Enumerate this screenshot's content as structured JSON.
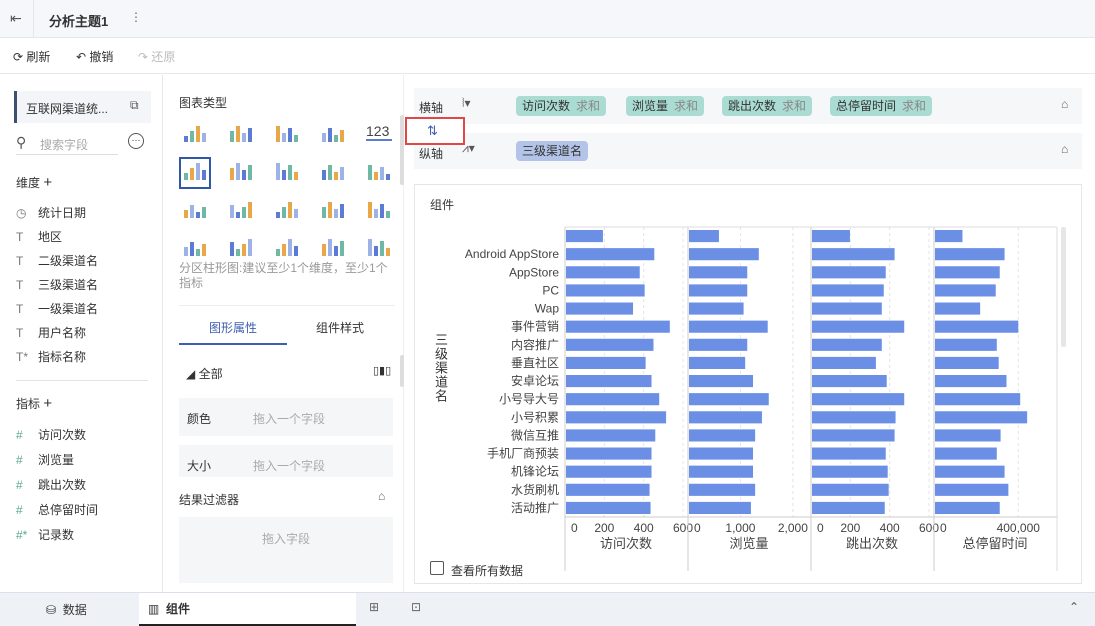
{
  "topbar": {
    "title": "分析主题1",
    "more": "⋮"
  },
  "toolbar": {
    "refresh": "刷新",
    "undo": "撤销",
    "redo": "还原"
  },
  "left": {
    "dataset": "互联网渠道统...",
    "search_placeholder": "搜索字段",
    "dimensions_label": "维度",
    "dimensions": [
      {
        "icon": "clock",
        "label": "统计日期"
      },
      {
        "icon": "T",
        "label": "地区"
      },
      {
        "icon": "T",
        "label": "二级渠道名"
      },
      {
        "icon": "T",
        "label": "三级渠道名"
      },
      {
        "icon": "T",
        "label": "一级渠道名"
      },
      {
        "icon": "T",
        "label": "用户名称"
      },
      {
        "icon": "T*",
        "label": "指标名称"
      }
    ],
    "measures_label": "指标",
    "measures": [
      {
        "icon": "#",
        "label": "访问次数"
      },
      {
        "icon": "#",
        "label": "浏览量"
      },
      {
        "icon": "#",
        "label": "跳出次数"
      },
      {
        "icon": "#",
        "label": "总停留时间"
      },
      {
        "icon": "#*",
        "label": "记录数"
      }
    ]
  },
  "mid": {
    "chart_type_label": "图表类型",
    "hint": "分区柱形图:建议至少1个维度，至少1个指标",
    "tabs": [
      "图形属性",
      "组件样式"
    ],
    "all_label": "全部",
    "color_label": "颜色",
    "color_placeholder": "拖入一个字段",
    "size_label": "大小",
    "size_placeholder": "拖入一个字段",
    "filter_label": "结果过滤器",
    "filter_placeholder": "拖入字段"
  },
  "axes": {
    "x_label": "横轴",
    "y_label": "纵轴",
    "x_pills": [
      {
        "name": "访问次数",
        "agg": "求和"
      },
      {
        "name": "浏览量",
        "agg": "求和"
      },
      {
        "name": "跳出次数",
        "agg": "求和"
      },
      {
        "name": "总停留时间",
        "agg": "求和"
      }
    ],
    "y_pills": [
      {
        "name": "三级渠道名"
      }
    ]
  },
  "component": {
    "title": "组件",
    "show_all": "查看所有数据"
  },
  "bottom": {
    "tabs": [
      "数据",
      "组件"
    ]
  },
  "colors": {
    "bar": "#6c8fe6",
    "accent": "#3d5fb0",
    "pill_x": "#aadcd3",
    "pill_y": "#b3c4e8",
    "highlight": "#e04848"
  },
  "chart_data": {
    "type": "bar",
    "orientation": "horizontal",
    "ylabel": "三级渠道名",
    "categories": [
      "",
      "Android AppStore",
      "AppStore",
      "PC",
      "Wap",
      "事件营销",
      "内容推广",
      "垂直社区",
      "安卓论坛",
      "小号导大号",
      "小号积累",
      "微信互推",
      "手机厂商预装",
      "机锋论坛",
      "水货刷机",
      "活动推广"
    ],
    "panels": [
      {
        "name": "访问次数",
        "ticks": [
          "0",
          "200",
          "400",
          "600"
        ],
        "tick_values": [
          0,
          200,
          400,
          600
        ],
        "xlim": [
          0,
          600
        ],
        "values": [
          193,
          454,
          380,
          405,
          346,
          533,
          450,
          410,
          440,
          479,
          514,
          459,
          440,
          440,
          430,
          435
        ]
      },
      {
        "name": "浏览量",
        "ticks": [
          "0",
          "1,000",
          "2,000"
        ],
        "tick_values": [
          0,
          1000,
          2000
        ],
        "xlim": [
          0,
          2250
        ],
        "values": [
          590,
          1350,
          1130,
          1130,
          1060,
          1520,
          1130,
          1090,
          1240,
          1540,
          1410,
          1280,
          1240,
          1240,
          1280,
          1200
        ]
      },
      {
        "name": "跳出次数",
        "ticks": [
          "0",
          "200",
          "400",
          "600"
        ],
        "tick_values": [
          0,
          200,
          400,
          600
        ],
        "xlim": [
          0,
          600
        ],
        "values": [
          198,
          425,
          380,
          370,
          360,
          474,
          360,
          330,
          385,
          474,
          430,
          425,
          380,
          390,
          395,
          375
        ]
      },
      {
        "name": "总停留时间",
        "ticks": [
          "0",
          "400,000"
        ],
        "tick_values": [
          0,
          400000
        ],
        "xlim": [
          0,
          560000
        ],
        "values": [
          135000,
          335000,
          312000,
          293000,
          219000,
          400000,
          298000,
          307000,
          344000,
          409000,
          442000,
          316000,
          298000,
          335000,
          353000,
          312000
        ]
      }
    ]
  }
}
